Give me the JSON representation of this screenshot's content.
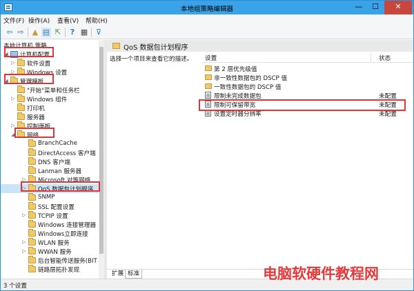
{
  "window": {
    "title": "本地组策略编辑器"
  },
  "menu": [
    "文件(F)",
    "操作(A)",
    "查看(V)",
    "帮助(H)"
  ],
  "toolbar": {
    "back_glyph": "⇦",
    "forward_glyph": "⇨",
    "up_glyph": "▲",
    "tree_glyph": "▤",
    "export_glyph": "⇱",
    "help_glyph": "?",
    "view_glyph": "▦",
    "filter_glyph": "⊽"
  },
  "tree": {
    "root": "本地计算机 策略",
    "items": [
      {
        "label": "计算机配置",
        "arrow": "◢",
        "level": 0,
        "icon": "computer"
      },
      {
        "label": "软件设置",
        "arrow": "▷",
        "level": 1,
        "icon": "folder"
      },
      {
        "label": "Windows 设置",
        "arrow": "▷",
        "level": 1,
        "icon": "folder"
      },
      {
        "label": "管理模板",
        "arrow": "◢",
        "level": 0,
        "icon": "folder"
      },
      {
        "label": "\"开始\"菜单和任务栏",
        "arrow": "",
        "level": 1,
        "icon": "folder"
      },
      {
        "label": "Windows 组件",
        "arrow": "▷",
        "level": 1,
        "icon": "folder"
      },
      {
        "label": "打印机",
        "arrow": "",
        "level": 1,
        "icon": "folder"
      },
      {
        "label": "服务器",
        "arrow": "",
        "level": 1,
        "icon": "folder"
      },
      {
        "label": "控制面板",
        "arrow": "▷",
        "level": 1,
        "icon": "folder"
      },
      {
        "label": "网络",
        "arrow": "◢",
        "level": 1,
        "icon": "folder"
      },
      {
        "label": "BranchCache",
        "arrow": "",
        "level": 2,
        "icon": "folder"
      },
      {
        "label": "DirectAccess 客户端",
        "arrow": "",
        "level": 2,
        "icon": "folder"
      },
      {
        "label": "DNS 客户端",
        "arrow": "",
        "level": 2,
        "icon": "folder"
      },
      {
        "label": "Lanman 服务器",
        "arrow": "",
        "level": 2,
        "icon": "folder"
      },
      {
        "label": "Microsoft 对等网络",
        "arrow": "▷",
        "level": 2,
        "icon": "folder"
      },
      {
        "label": "QoS 数据包计划程序",
        "arrow": "▷",
        "level": 2,
        "icon": "folder",
        "selected": true
      },
      {
        "label": "SNMP",
        "arrow": "",
        "level": 2,
        "icon": "folder"
      },
      {
        "label": "SSL 配置设置",
        "arrow": "",
        "level": 2,
        "icon": "folder"
      },
      {
        "label": "TCPIP 设置",
        "arrow": "▷",
        "level": 2,
        "icon": "folder"
      },
      {
        "label": "Windows 连接管理器",
        "arrow": "",
        "level": 2,
        "icon": "folder"
      },
      {
        "label": "Windows立即连接",
        "arrow": "",
        "level": 2,
        "icon": "folder"
      },
      {
        "label": "WLAN 服务",
        "arrow": "▷",
        "level": 2,
        "icon": "folder"
      },
      {
        "label": "WWAN 服务",
        "arrow": "▷",
        "level": 2,
        "icon": "folder"
      },
      {
        "label": "后台智能传送服务(BIT",
        "arrow": "",
        "level": 2,
        "icon": "folder"
      },
      {
        "label": "链路层拓扑发现",
        "arrow": "",
        "level": 2,
        "icon": "folder"
      }
    ]
  },
  "panel": {
    "title": "QoS 数据包计划程序",
    "description": "选择一个项目来查看它的描述。",
    "columns": {
      "setting": "设置",
      "state": "状态"
    },
    "rows": [
      {
        "name": "第 2 层优先级值",
        "state": "",
        "icon": "folder"
      },
      {
        "name": "非一致性数据包的 DSCP 值",
        "state": "",
        "icon": "folder"
      },
      {
        "name": "一致性数据包的 DSCP 值",
        "state": "",
        "icon": "folder"
      },
      {
        "name": "限制未完成数据包",
        "state": "未配置",
        "icon": "setting"
      },
      {
        "name": "限制可保留带宽",
        "state": "未配置",
        "icon": "setting"
      },
      {
        "name": "设置定时器分辨率",
        "state": "未配置",
        "icon": "setting"
      }
    ],
    "tabs": [
      "扩展",
      "标准"
    ]
  },
  "status": {
    "text": "3 个设置"
  },
  "watermark": "电脑软硬件教程网",
  "colors": {
    "titlebar": "#3aa2e6",
    "highlight": "#e53237",
    "close": "#c7463d"
  }
}
